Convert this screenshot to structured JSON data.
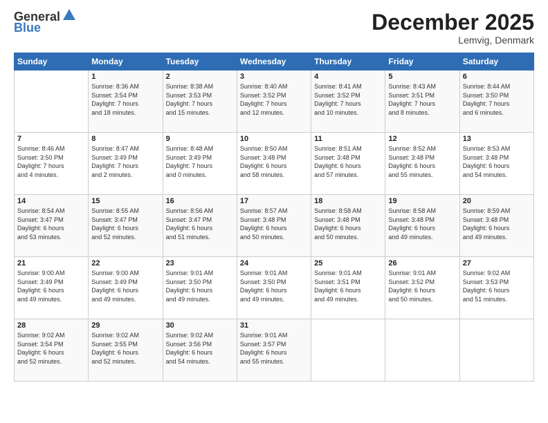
{
  "header": {
    "logo_general": "General",
    "logo_blue": "Blue",
    "month_title": "December 2025",
    "subtitle": "Lemvig, Denmark"
  },
  "calendar": {
    "days_of_week": [
      "Sunday",
      "Monday",
      "Tuesday",
      "Wednesday",
      "Thursday",
      "Friday",
      "Saturday"
    ],
    "weeks": [
      [
        {
          "day": "",
          "info": ""
        },
        {
          "day": "1",
          "info": "Sunrise: 8:36 AM\nSunset: 3:54 PM\nDaylight: 7 hours\nand 18 minutes."
        },
        {
          "day": "2",
          "info": "Sunrise: 8:38 AM\nSunset: 3:53 PM\nDaylight: 7 hours\nand 15 minutes."
        },
        {
          "day": "3",
          "info": "Sunrise: 8:40 AM\nSunset: 3:52 PM\nDaylight: 7 hours\nand 12 minutes."
        },
        {
          "day": "4",
          "info": "Sunrise: 8:41 AM\nSunset: 3:52 PM\nDaylight: 7 hours\nand 10 minutes."
        },
        {
          "day": "5",
          "info": "Sunrise: 8:43 AM\nSunset: 3:51 PM\nDaylight: 7 hours\nand 8 minutes."
        },
        {
          "day": "6",
          "info": "Sunrise: 8:44 AM\nSunset: 3:50 PM\nDaylight: 7 hours\nand 6 minutes."
        }
      ],
      [
        {
          "day": "7",
          "info": "Sunrise: 8:46 AM\nSunset: 3:50 PM\nDaylight: 7 hours\nand 4 minutes."
        },
        {
          "day": "8",
          "info": "Sunrise: 8:47 AM\nSunset: 3:49 PM\nDaylight: 7 hours\nand 2 minutes."
        },
        {
          "day": "9",
          "info": "Sunrise: 8:48 AM\nSunset: 3:49 PM\nDaylight: 7 hours\nand 0 minutes."
        },
        {
          "day": "10",
          "info": "Sunrise: 8:50 AM\nSunset: 3:48 PM\nDaylight: 6 hours\nand 58 minutes."
        },
        {
          "day": "11",
          "info": "Sunrise: 8:51 AM\nSunset: 3:48 PM\nDaylight: 6 hours\nand 57 minutes."
        },
        {
          "day": "12",
          "info": "Sunrise: 8:52 AM\nSunset: 3:48 PM\nDaylight: 6 hours\nand 55 minutes."
        },
        {
          "day": "13",
          "info": "Sunrise: 8:53 AM\nSunset: 3:48 PM\nDaylight: 6 hours\nand 54 minutes."
        }
      ],
      [
        {
          "day": "14",
          "info": "Sunrise: 8:54 AM\nSunset: 3:47 PM\nDaylight: 6 hours\nand 53 minutes."
        },
        {
          "day": "15",
          "info": "Sunrise: 8:55 AM\nSunset: 3:47 PM\nDaylight: 6 hours\nand 52 minutes."
        },
        {
          "day": "16",
          "info": "Sunrise: 8:56 AM\nSunset: 3:47 PM\nDaylight: 6 hours\nand 51 minutes."
        },
        {
          "day": "17",
          "info": "Sunrise: 8:57 AM\nSunset: 3:48 PM\nDaylight: 6 hours\nand 50 minutes."
        },
        {
          "day": "18",
          "info": "Sunrise: 8:58 AM\nSunset: 3:48 PM\nDaylight: 6 hours\nand 50 minutes."
        },
        {
          "day": "19",
          "info": "Sunrise: 8:58 AM\nSunset: 3:48 PM\nDaylight: 6 hours\nand 49 minutes."
        },
        {
          "day": "20",
          "info": "Sunrise: 8:59 AM\nSunset: 3:48 PM\nDaylight: 6 hours\nand 49 minutes."
        }
      ],
      [
        {
          "day": "21",
          "info": "Sunrise: 9:00 AM\nSunset: 3:49 PM\nDaylight: 6 hours\nand 49 minutes."
        },
        {
          "day": "22",
          "info": "Sunrise: 9:00 AM\nSunset: 3:49 PM\nDaylight: 6 hours\nand 49 minutes."
        },
        {
          "day": "23",
          "info": "Sunrise: 9:01 AM\nSunset: 3:50 PM\nDaylight: 6 hours\nand 49 minutes."
        },
        {
          "day": "24",
          "info": "Sunrise: 9:01 AM\nSunset: 3:50 PM\nDaylight: 6 hours\nand 49 minutes."
        },
        {
          "day": "25",
          "info": "Sunrise: 9:01 AM\nSunset: 3:51 PM\nDaylight: 6 hours\nand 49 minutes."
        },
        {
          "day": "26",
          "info": "Sunrise: 9:01 AM\nSunset: 3:52 PM\nDaylight: 6 hours\nand 50 minutes."
        },
        {
          "day": "27",
          "info": "Sunrise: 9:02 AM\nSunset: 3:53 PM\nDaylight: 6 hours\nand 51 minutes."
        }
      ],
      [
        {
          "day": "28",
          "info": "Sunrise: 9:02 AM\nSunset: 3:54 PM\nDaylight: 6 hours\nand 52 minutes."
        },
        {
          "day": "29",
          "info": "Sunrise: 9:02 AM\nSunset: 3:55 PM\nDaylight: 6 hours\nand 52 minutes."
        },
        {
          "day": "30",
          "info": "Sunrise: 9:02 AM\nSunset: 3:56 PM\nDaylight: 6 hours\nand 54 minutes."
        },
        {
          "day": "31",
          "info": "Sunrise: 9:01 AM\nSunset: 3:57 PM\nDaylight: 6 hours\nand 55 minutes."
        },
        {
          "day": "",
          "info": ""
        },
        {
          "day": "",
          "info": ""
        },
        {
          "day": "",
          "info": ""
        }
      ]
    ]
  }
}
